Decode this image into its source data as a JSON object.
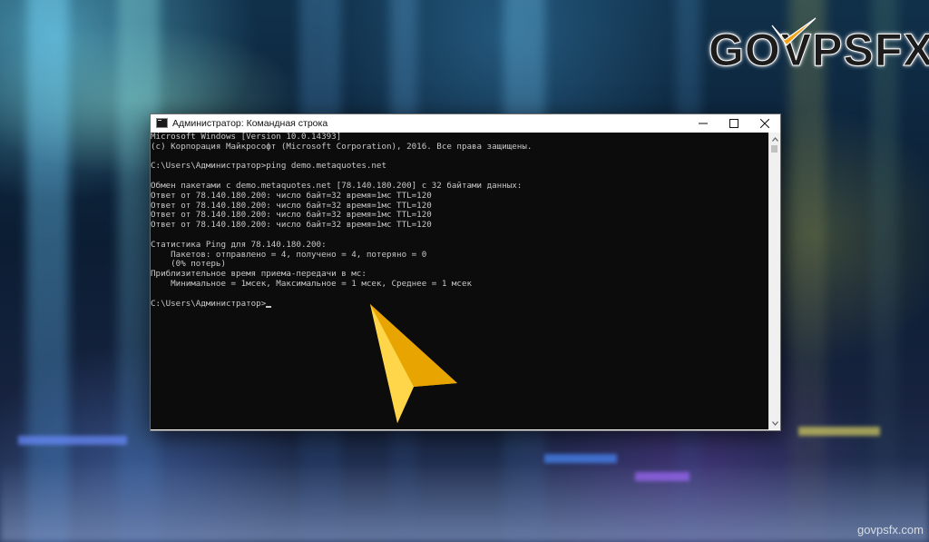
{
  "brand": {
    "logo_text": "GOVPSFX",
    "watermark": "govpsfx.com",
    "accent_color": "#f2a21b"
  },
  "window": {
    "title": "Администратор: Командная строка",
    "icon": "console-icon",
    "controls": {
      "minimize": "minimize-icon",
      "maximize": "maximize-icon",
      "close": "close-icon"
    }
  },
  "console": {
    "lines": [
      "Microsoft Windows [Version 10.0.14393]",
      "(c) Корпорация Майкрософт (Microsoft Corporation), 2016. Все права защищены.",
      "",
      "C:\\Users\\Администратор>ping demo.metaquotes.net",
      "",
      "Обмен пакетами с demo.metaquotes.net [78.140.180.200] с 32 байтами данных:",
      "Ответ от 78.140.180.200: число байт=32 время=1мс TTL=120",
      "Ответ от 78.140.180.200: число байт=32 время=1мс TTL=120",
      "Ответ от 78.140.180.200: число байт=32 время=1мс TTL=120",
      "Ответ от 78.140.180.200: число байт=32 время=1мс TTL=120",
      "",
      "Статистика Ping для 78.140.180.200:",
      "    Пакетов: отправлено = 4, получено = 4, потеряно = 0",
      "    (0% потерь)",
      "Приблизительное время приема-передачи в мс:",
      "    Минимальное = 1мсек, Максимальное = 1 мсек, Среднее = 1 мсек",
      ""
    ],
    "prompt": "C:\\Users\\Администратор>",
    "text_color": "#c8c8c8",
    "background_color": "#0c0c0c"
  },
  "overlay": {
    "pointer_icon": "yellow-arrow-pointer-icon",
    "pointer_color": "#ffc20e"
  }
}
